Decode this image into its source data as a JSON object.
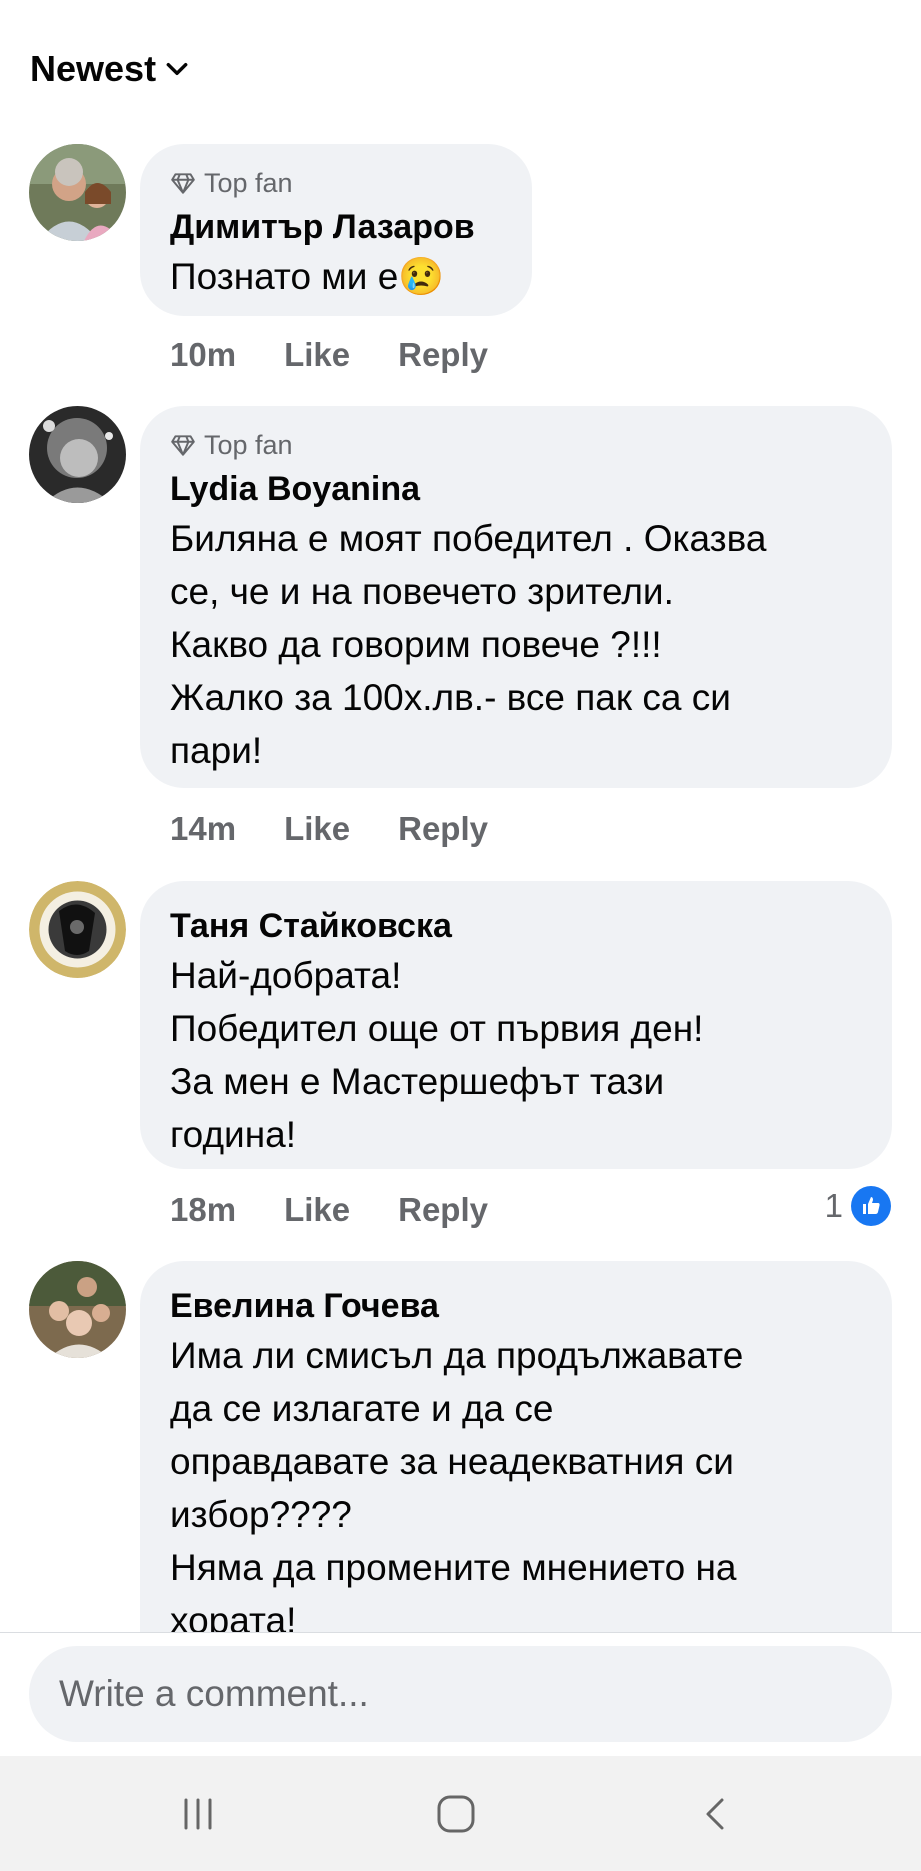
{
  "sort": {
    "label": "Newest"
  },
  "comments": [
    {
      "top_fan_label": "Top fan",
      "name": "Димитър Лазаров",
      "text": "Познато ми е",
      "emoji": "😢",
      "time": "10m",
      "like_label": "Like",
      "reply_label": "Reply"
    },
    {
      "top_fan_label": "Top fan",
      "name": "Lydia Boyanina",
      "text": "Биляна е моят победител . Оказва\nсе, че и на повечето  зрители.\nКакво да говорим повече ?!!!\nЖалко за 100х.лв.- все пак са си\nпари!",
      "time": "14m",
      "like_label": "Like",
      "reply_label": "Reply"
    },
    {
      "name": "Таня Стайковска",
      "text": "Най-добрата!\nПобедител още от първия ден!\nЗа мен е Мастершефът тази\nгодина!",
      "time": "18m",
      "like_label": "Like",
      "reply_label": "Reply",
      "reaction_count": "1"
    },
    {
      "name": "Евелина Гочева",
      "text": "Има ли смисъл да продължавате\nда се излагате и да се\nоправдавате за неадекватния си\nизбор????\nНяма да промените мнението на\nхората!"
    }
  ],
  "composer": {
    "placeholder": "Write a comment..."
  },
  "colors": {
    "bubble": "#f0f2f5",
    "accent": "#1877f2",
    "muted": "#65676b"
  }
}
